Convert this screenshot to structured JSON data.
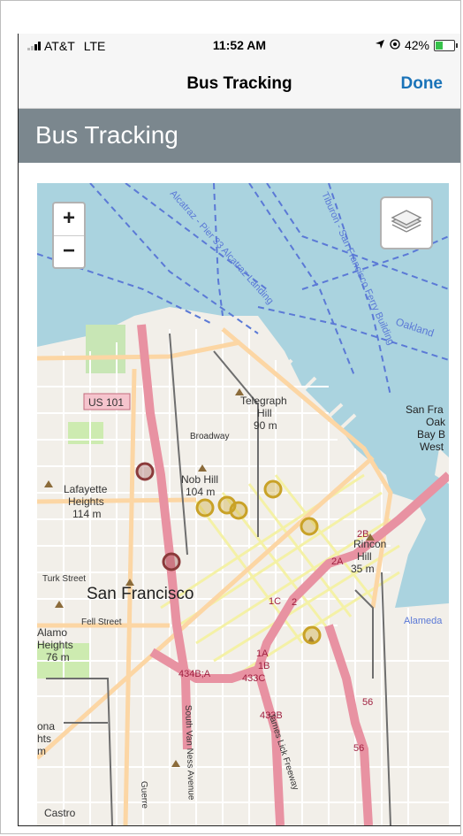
{
  "status_bar": {
    "carrier": "AT&T",
    "network": "LTE",
    "time": "11:52 AM",
    "battery": "42%",
    "battery_level": 0.42
  },
  "nav_bar": {
    "title": "Bus Tracking",
    "done_label": "Done"
  },
  "page": {
    "header": "Bus Tracking"
  },
  "map": {
    "zoom_in": "+",
    "zoom_out": "−",
    "labels": {
      "alcatraz_pier": "Alcatraz - Pier 33 Alcatraz Landing",
      "tiburon_ferry": "Tiburon - San Francisco Ferry Building",
      "oakland": "Oakland",
      "us101": "US 101",
      "telegraph_hill": "Telegraph",
      "telegraph_hill2": "Hill",
      "telegraph_elev": "90 m",
      "broadway": "Broadway",
      "nob_hill": "Nob Hill",
      "nob_hill_elev": "104 m",
      "lafayette": "Lafayette",
      "lafayette2": "Heights",
      "lafayette_elev": "114 m",
      "turk": "Turk Street",
      "sf": "San Francisco",
      "fell": "Fell Street",
      "alamo": "Alamo",
      "alamo2": "Heights",
      "alamo_elev": "76 m",
      "rincon": "Rincon",
      "rincon2": "Hill",
      "rincon_elev": "35 m",
      "sf_oak": "San Fra",
      "sf_oak2": "Oak",
      "sf_oak3": "Bay B",
      "sf_oak4": "West",
      "alameda": "Alameda",
      "r2b": "2B",
      "r2a": "2A",
      "r1c": "1C",
      "r2": "2",
      "r1a": "1A",
      "r1b": "1B",
      "r433c": "433C",
      "r434ba": "434B;A",
      "r433b": "433B",
      "r56a": "56",
      "r56b": "56",
      "vanness": "South Van Ness Avenue",
      "jameslick": "James Lick Freeway",
      "guerrero": "Guerre",
      "castro": "Castro",
      "ona": "ona",
      "hts": "hts",
      "m": "m"
    },
    "colors": {
      "water": "#aad3df",
      "land": "#f2efe9",
      "highway": "#e892a2",
      "primary": "#fcd6a4",
      "bus_marker": "#c9a227",
      "bus_marker_alt": "#8b3a3a",
      "ferry_route": "#5b79d6"
    }
  }
}
